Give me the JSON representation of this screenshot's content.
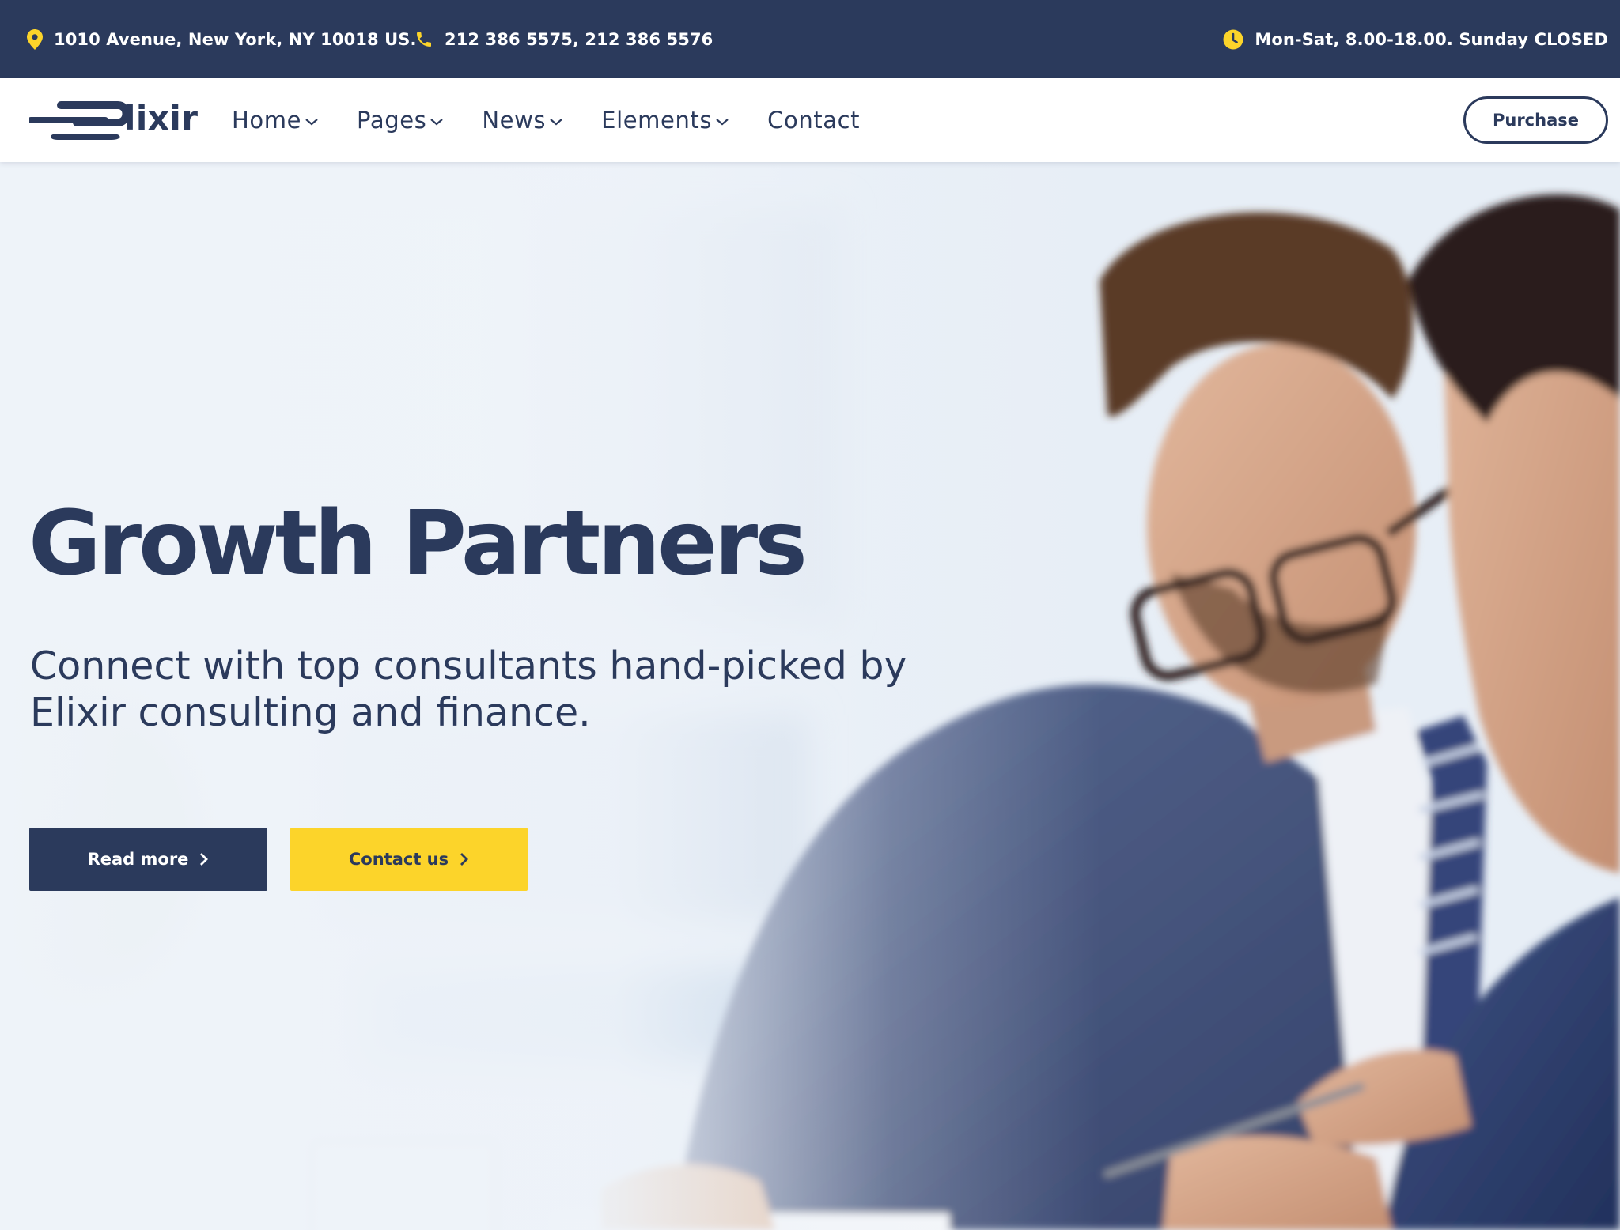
{
  "colors": {
    "navy": "#2b3a5c",
    "accent_yellow": "#fcd42a",
    "white": "#ffffff"
  },
  "topbar": {
    "address": {
      "icon": "map-pin-icon",
      "text": "1010 Avenue, New York, NY 10018 US."
    },
    "phone": {
      "icon": "phone-icon",
      "text": "212 386 5575, 212 386 5576"
    },
    "hours": {
      "icon": "clock-icon",
      "text": "Mon-Sat, 8.00-18.00. Sunday CLOSED"
    }
  },
  "navbar": {
    "logo_text": "lixir",
    "menu": [
      {
        "label": "Home",
        "has_dropdown": true
      },
      {
        "label": "Pages",
        "has_dropdown": true
      },
      {
        "label": "News",
        "has_dropdown": true
      },
      {
        "label": "Elements",
        "has_dropdown": true
      },
      {
        "label": "Contact",
        "has_dropdown": false
      }
    ],
    "purchase_label": "Purchase"
  },
  "hero": {
    "title": "Growth Partners",
    "subtitle": "Connect with top consultants hand-picked by Elixir consulting and finance.",
    "buttons": {
      "read_more": "Read more",
      "contact_us": "Contact us"
    }
  }
}
